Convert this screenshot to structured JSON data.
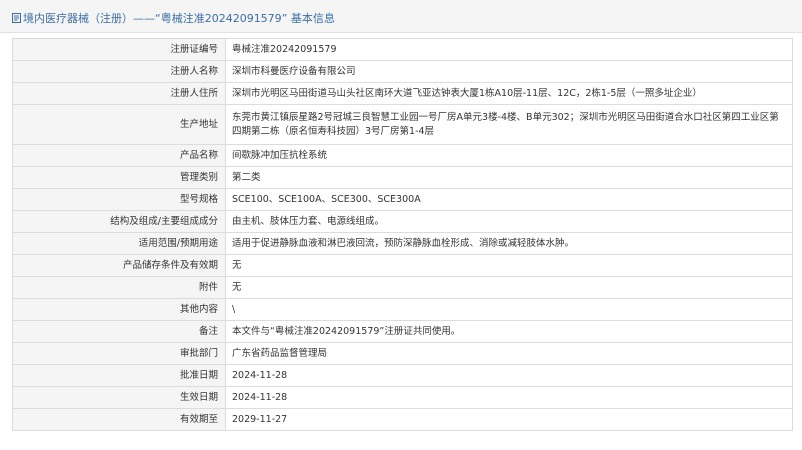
{
  "header": {
    "prefix": "境内医疗器械（注册）——",
    "reg_no_quoted": "“粤械注准20242091579”",
    "suffix": "基本信息"
  },
  "rows": [
    {
      "label": "注册证编号",
      "value": "粤械注准20242091579"
    },
    {
      "label": "注册人名称",
      "value": "深圳市科曼医疗设备有限公司"
    },
    {
      "label": "注册人住所",
      "value": "深圳市光明区马田街道马山头社区南环大道飞亚达钟表大厦1栋A10层-11层、12C，2栋1-5层（一照多址企业）"
    },
    {
      "label": "生产地址",
      "value": "东莞市黄江镇辰星路2号冠城三良智慧工业园一号厂房A单元3楼-4楼、B单元302；深圳市光明区马田街道合水口社区第四工业区第四期第二栋（原名恒寿科技园）3号厂房第1-4层"
    },
    {
      "label": "产品名称",
      "value": "间歇脉冲加压抗栓系统"
    },
    {
      "label": "管理类别",
      "value": "第二类"
    },
    {
      "label": "型号规格",
      "value": "SCE100、SCE100A、SCE300、SCE300A"
    },
    {
      "label": "结构及组成/主要组成成分",
      "value": "由主机、肢体压力套、电源线组成。"
    },
    {
      "label": "适用范围/预期用途",
      "value": "适用于促进静脉血液和淋巴液回流，预防深静脉血栓形成、消除或减轻肢体水肿。"
    },
    {
      "label": "产品储存条件及有效期",
      "value": "无"
    },
    {
      "label": "附件",
      "value": "无"
    },
    {
      "label": "其他内容",
      "value": "\\"
    },
    {
      "label": "备注",
      "value": "本文件与“粤械注准20242091579”注册证共同使用。"
    },
    {
      "label": "审批部门",
      "value": "广东省药品监督管理局"
    },
    {
      "label": "批准日期",
      "value": "2024-11-28"
    },
    {
      "label": "生效日期",
      "value": "2024-11-28"
    },
    {
      "label": "有效期至",
      "value": "2029-11-27"
    }
  ],
  "colors": {
    "accent": "#3a6ea5",
    "label_bg": "#f5f5f5",
    "border": "#dcdcdc"
  },
  "icons": {
    "title": "document-icon"
  }
}
